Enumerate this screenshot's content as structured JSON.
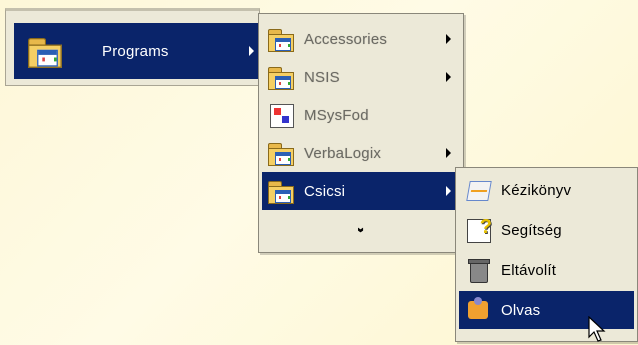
{
  "start_menu": {
    "programs_label": "Programs"
  },
  "programs_menu": {
    "items": [
      {
        "label": "Accessories",
        "icon": "program-folder-icon",
        "has_submenu": true
      },
      {
        "label": "NSIS",
        "icon": "program-folder-icon",
        "has_submenu": true
      },
      {
        "label": "MSysFod",
        "icon": "application-icon",
        "has_submenu": false
      },
      {
        "label": "VerbaLogix",
        "icon": "program-folder-icon",
        "has_submenu": true
      },
      {
        "label": "Csicsi",
        "icon": "program-folder-icon",
        "has_submenu": true
      }
    ],
    "more_icon": "double-chevron-down-icon"
  },
  "csicsi_menu": {
    "items": [
      {
        "label": "Kézikönyv",
        "icon": "manual-icon"
      },
      {
        "label": "Segítség",
        "icon": "help-icon"
      },
      {
        "label": "Eltávolít",
        "icon": "uninstall-icon"
      },
      {
        "label": "Olvas",
        "icon": "reader-icon"
      }
    ]
  },
  "colors": {
    "highlight": "#0a246a",
    "menu_bg": "#ece9d8",
    "desktop": "#fdf7d8"
  }
}
